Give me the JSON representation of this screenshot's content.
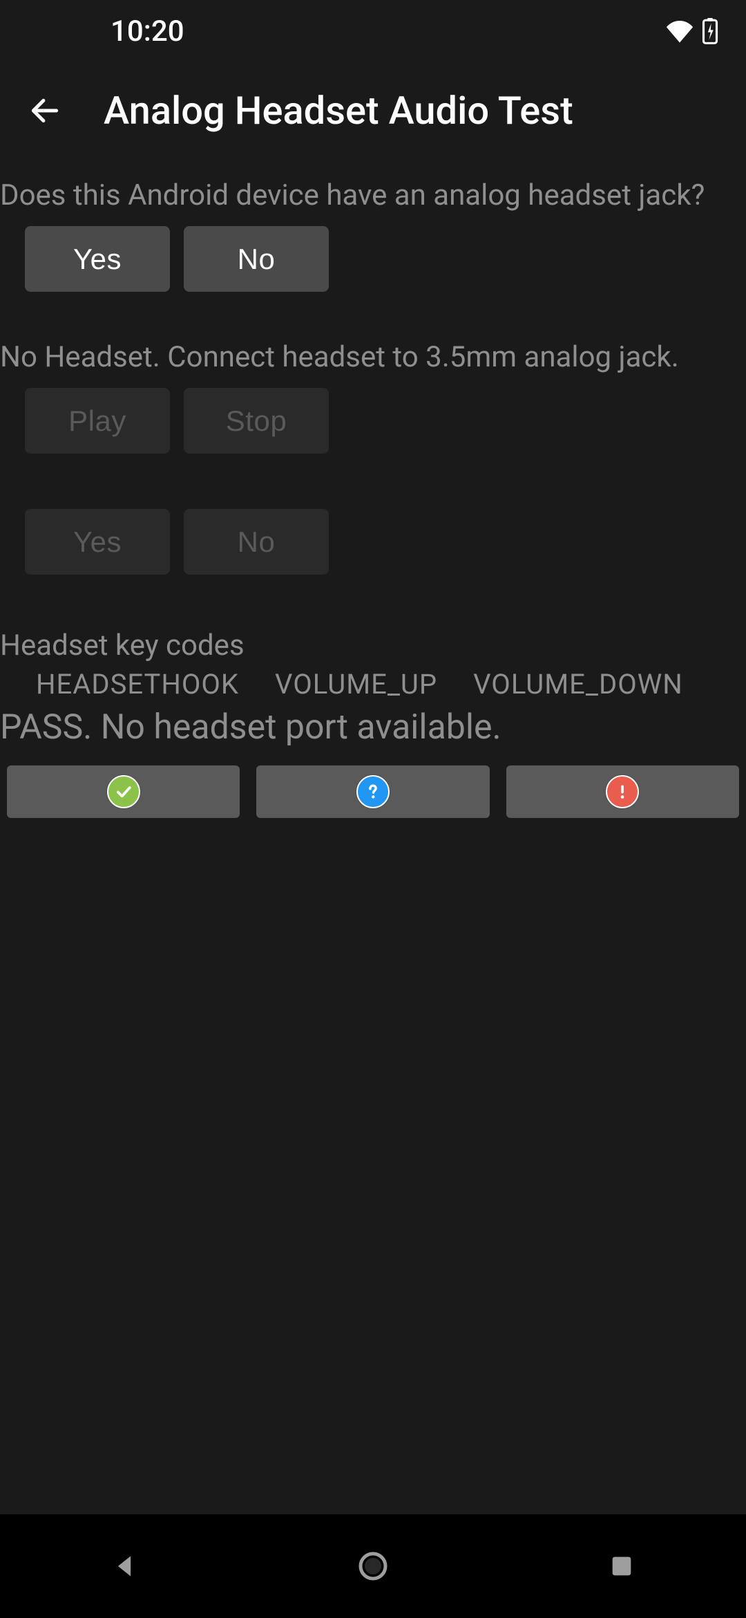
{
  "status_bar": {
    "time": "10:20"
  },
  "header": {
    "title": "Analog Headset Audio Test"
  },
  "question1": {
    "text": "Does this Android device have an analog headset jack?",
    "yes_label": "Yes",
    "no_label": "No"
  },
  "headset_status": "No Headset. Connect headset to 3.5mm analog jack.",
  "playback": {
    "play_label": "Play",
    "stop_label": "Stop"
  },
  "confirm2": {
    "yes_label": "Yes",
    "no_label": "No"
  },
  "keycodes": {
    "label": "Headset key codes",
    "items": [
      "HEADSETHOOK",
      "VOLUME_UP",
      "VOLUME_DOWN"
    ]
  },
  "result_text": "PASS. No headset port available."
}
